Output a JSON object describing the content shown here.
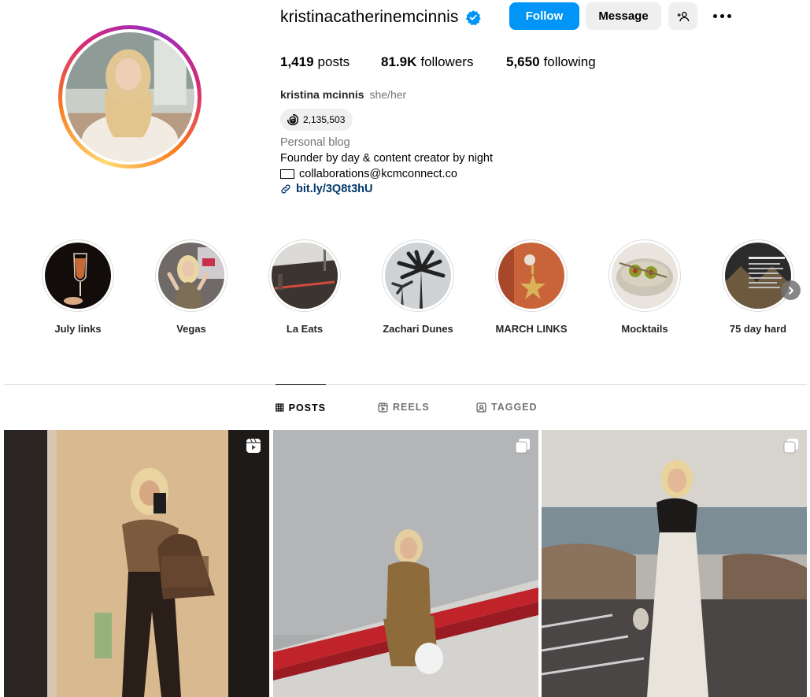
{
  "profile": {
    "username": "kristinacatherinemcinnis",
    "verified": true,
    "full_name": "kristina mcinnis",
    "pronouns": "she/her",
    "threads_count": "2,135,503",
    "category": "Personal blog",
    "bio": "Founder by day & content creator by night",
    "email": "collaborations@kcmconnect.co",
    "link": "bit.ly/3Q8t3hU"
  },
  "actions": {
    "follow_label": "Follow",
    "message_label": "Message",
    "add_user_icon": "person-add-icon",
    "more_icon": "more-horizontal-icon"
  },
  "stats": {
    "posts_count": "1,419",
    "posts_label": "posts",
    "followers_count": "81.9K",
    "followers_label": "followers",
    "following_count": "5,650",
    "following_label": "following"
  },
  "highlights": [
    {
      "label": "July links"
    },
    {
      "label": "Vegas"
    },
    {
      "label": "La Eats"
    },
    {
      "label": "Zachari Dunes"
    },
    {
      "label": "MARCH LINKS"
    },
    {
      "label": "Mocktails"
    },
    {
      "label": "75 day hard"
    }
  ],
  "tabs": [
    {
      "label": "POSTS",
      "icon": "grid-icon",
      "active": true
    },
    {
      "label": "REELS",
      "icon": "reels-icon",
      "active": false
    },
    {
      "label": "TAGGED",
      "icon": "tagged-icon",
      "active": false
    }
  ],
  "posts": [
    {
      "badge": "reel-icon"
    },
    {
      "badge": "carousel-icon"
    },
    {
      "badge": "carousel-icon"
    }
  ],
  "colors": {
    "accent": "#0095f6",
    "link": "#00376b",
    "secondary_text": "#737373",
    "button_bg": "#efefef"
  }
}
